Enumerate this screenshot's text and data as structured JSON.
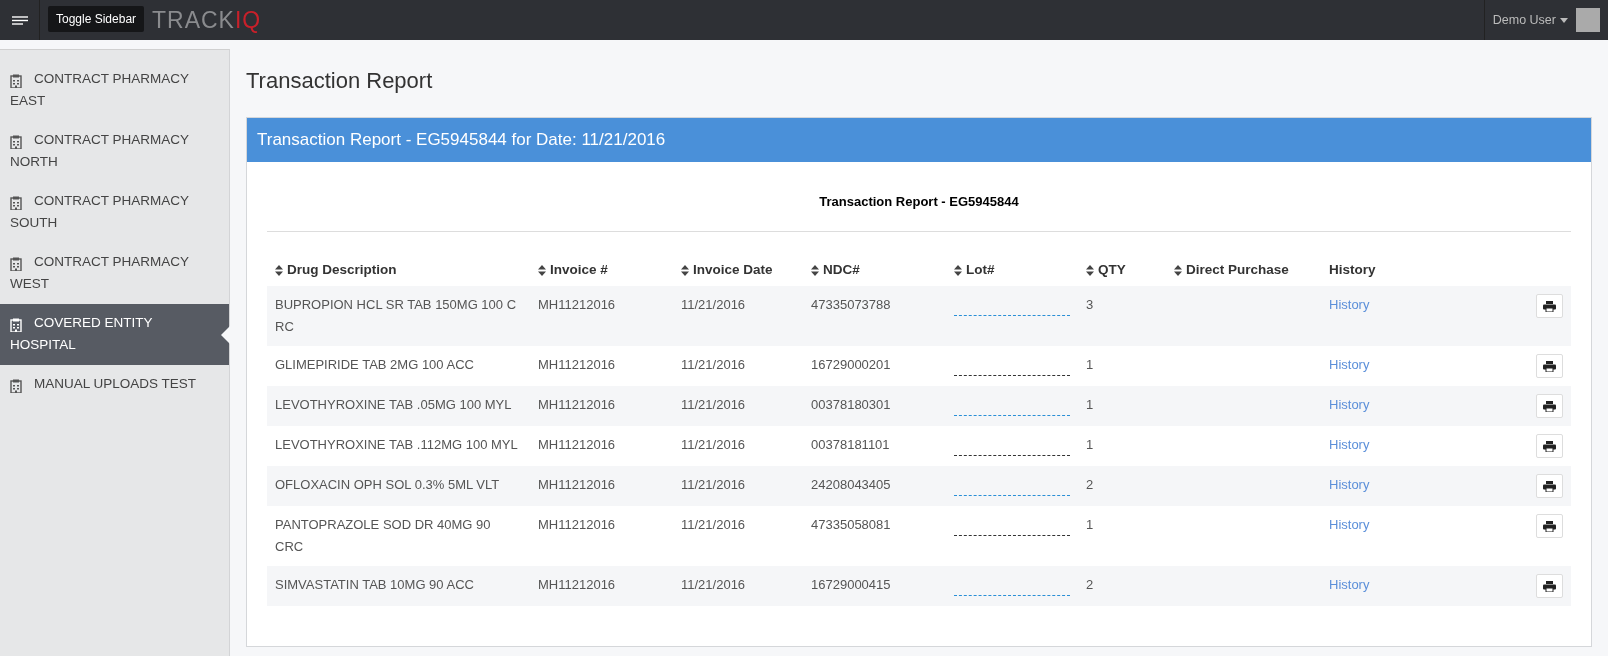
{
  "navbar": {
    "logo": {
      "text": "TRACK",
      "accent": "IQ"
    },
    "tooltip": "Toggle Sidebar",
    "user": "Demo User"
  },
  "sidebar": {
    "items": [
      {
        "label": "CONTRACT PHARMACY EAST",
        "selected": false
      },
      {
        "label": "CONTRACT PHARMACY NORTH",
        "selected": false
      },
      {
        "label": "CONTRACT PHARMACY SOUTH",
        "selected": false
      },
      {
        "label": "CONTRACT PHARMACY WEST",
        "selected": false
      },
      {
        "label": "COVERED ENTITY HOSPITAL",
        "selected": true
      },
      {
        "label": "MANUAL UPLOADS TEST",
        "selected": false
      }
    ]
  },
  "page_title": "Transaction Report",
  "panel": {
    "title": "Transaction Report - EG5945844 for Date: 11/21/2016",
    "report_heading": "Transaction Report - EG5945844",
    "table": {
      "columns": [
        {
          "label": "Drug Description",
          "sortable": true
        },
        {
          "label": "Invoice #",
          "sortable": true
        },
        {
          "label": "Invoice Date",
          "sortable": true
        },
        {
          "label": "NDC#",
          "sortable": true
        },
        {
          "label": "Lot#",
          "sortable": true
        },
        {
          "label": "QTY",
          "sortable": true
        },
        {
          "label": "Direct Purchase",
          "sortable": true
        },
        {
          "label": "History",
          "sortable": false
        }
      ],
      "rows": [
        {
          "drug": "BUPROPION HCL SR TAB 150MG 100 C RC",
          "invoice": "MH11212016",
          "date": "11/21/2016",
          "ndc": "47335073788",
          "qty": "3",
          "history": "History"
        },
        {
          "drug": "GLIMEPIRIDE TAB 2MG 100 ACC",
          "invoice": "MH11212016",
          "date": "11/21/2016",
          "ndc": "16729000201",
          "qty": "1",
          "history": "History"
        },
        {
          "drug": "LEVOTHYROXINE TAB .05MG 100 MYL",
          "invoice": "MH11212016",
          "date": "11/21/2016",
          "ndc": "00378180301",
          "qty": "1",
          "history": "History"
        },
        {
          "drug": "LEVOTHYROXINE TAB .112MG 100 MYL",
          "invoice": "MH11212016",
          "date": "11/21/2016",
          "ndc": "00378181101",
          "qty": "1",
          "history": "History"
        },
        {
          "drug": "OFLOXACIN OPH SOL 0.3% 5ML VLT",
          "invoice": "MH11212016",
          "date": "11/21/2016",
          "ndc": "24208043405",
          "qty": "2",
          "history": "History"
        },
        {
          "drug": "PANTOPRAZOLE SOD DR 40MG 90 CRC",
          "invoice": "MH11212016",
          "date": "11/21/2016",
          "ndc": "47335058081",
          "qty": "1",
          "history": "History"
        },
        {
          "drug": "SIMVASTATIN TAB 10MG 90 ACC",
          "invoice": "MH11212016",
          "date": "11/21/2016",
          "ndc": "16729000415",
          "qty": "2",
          "history": "History"
        }
      ]
    }
  }
}
